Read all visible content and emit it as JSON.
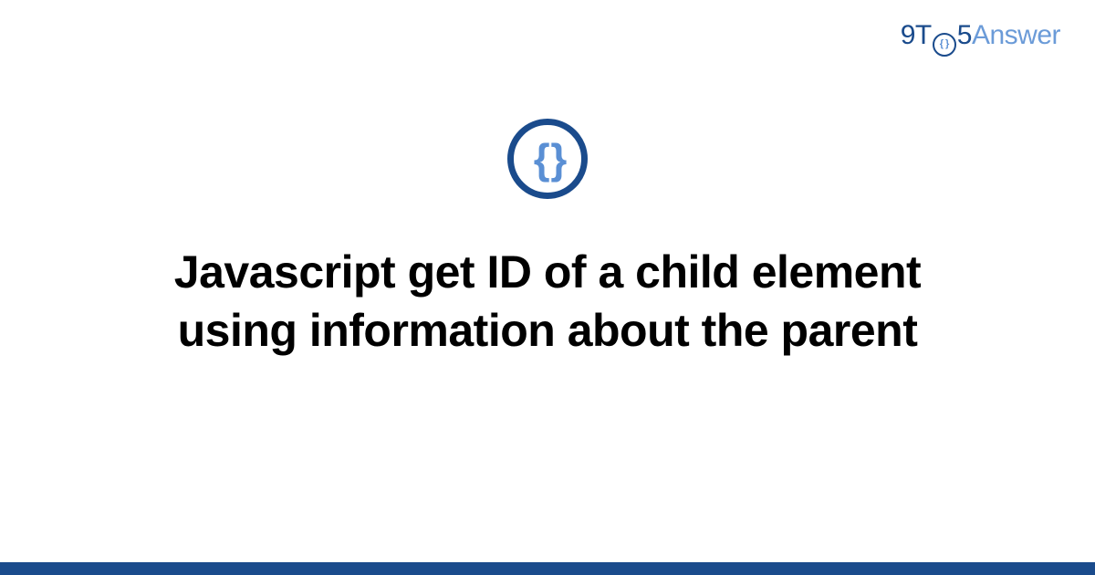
{
  "logo": {
    "part1": "9T",
    "circle_inner": "{ }",
    "part2": "5",
    "part3": "Answer"
  },
  "icon": {
    "name": "code-braces-icon",
    "glyph": "{ }"
  },
  "title": "Javascript get ID of a child element using information about the parent"
}
